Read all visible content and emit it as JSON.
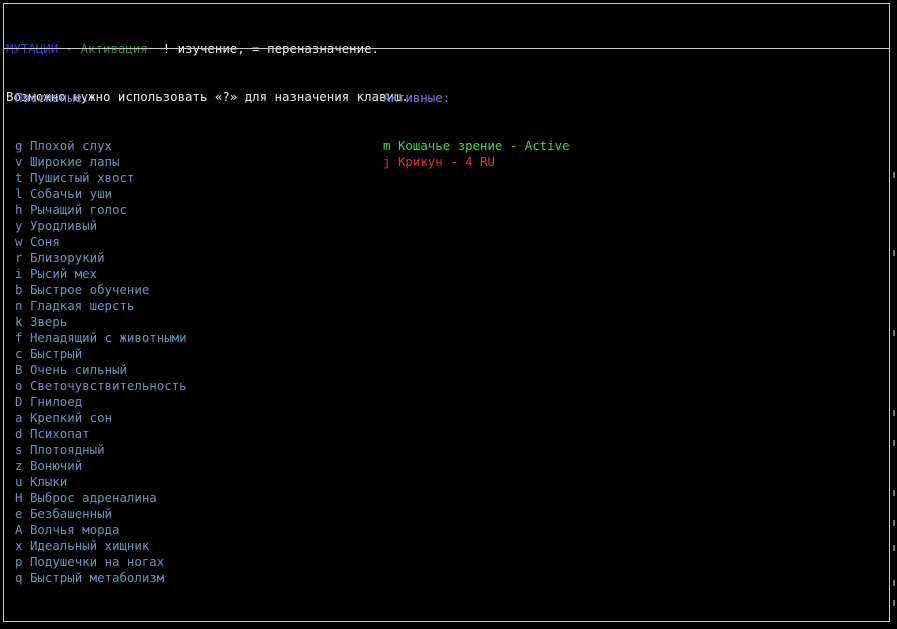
{
  "header": {
    "mutations_label": "МУТАЦИИ",
    "separator": " - ",
    "activation_label": "Активация",
    "hint_suffix": "  ! изучение, = переназначение.",
    "line2": "Возможно нужно использовать «?» для назначения клавиш."
  },
  "passive": {
    "title": "Пассивные:",
    "items": [
      {
        "key": "g",
        "name": "Плохой слух"
      },
      {
        "key": "v",
        "name": "Широкие лапы"
      },
      {
        "key": "t",
        "name": "Пушистый хвост"
      },
      {
        "key": "l",
        "name": "Собачьи уши"
      },
      {
        "key": "h",
        "name": "Рычащий голос"
      },
      {
        "key": "y",
        "name": "Уродливый"
      },
      {
        "key": "w",
        "name": "Соня"
      },
      {
        "key": "r",
        "name": "Близорукий"
      },
      {
        "key": "i",
        "name": "Рысий мех"
      },
      {
        "key": "b",
        "name": "Быстрое обучение"
      },
      {
        "key": "n",
        "name": "Гладкая шерсть"
      },
      {
        "key": "k",
        "name": "Зверь"
      },
      {
        "key": "f",
        "name": "Неладящий с животными"
      },
      {
        "key": "c",
        "name": "Быстрый"
      },
      {
        "key": "B",
        "name": "Очень сильный"
      },
      {
        "key": "o",
        "name": "Светочувствительность"
      },
      {
        "key": "D",
        "name": "Гнилоед"
      },
      {
        "key": "a",
        "name": "Крепкий сон"
      },
      {
        "key": "d",
        "name": "Психопат"
      },
      {
        "key": "s",
        "name": "Плотоядный"
      },
      {
        "key": "z",
        "name": "Вонючий"
      },
      {
        "key": "u",
        "name": "Клыки"
      },
      {
        "key": "H",
        "name": "Выброс адреналина"
      },
      {
        "key": "e",
        "name": "Безбашенный"
      },
      {
        "key": "A",
        "name": "Волчья морда"
      },
      {
        "key": "x",
        "name": "Идеальный хищник"
      },
      {
        "key": "p",
        "name": "Подушечки на ногах"
      },
      {
        "key": "q",
        "name": "Быстрый метаболизм"
      }
    ]
  },
  "active": {
    "title": "Активные:",
    "items": [
      {
        "key": "m",
        "name": "Кошачье зрение",
        "status": "Active",
        "state": "on"
      },
      {
        "key": "j",
        "name": "Крикун",
        "status": "4 RU",
        "state": "off"
      }
    ]
  },
  "colors": {
    "background": "#000000",
    "mutations": "#3a3ad8",
    "activation": "#3a8a3a",
    "passive_item": "#5e9ab8",
    "column_title": "#7a7ae8",
    "active_on": "#39d84a",
    "active_off": "#e03232"
  }
}
